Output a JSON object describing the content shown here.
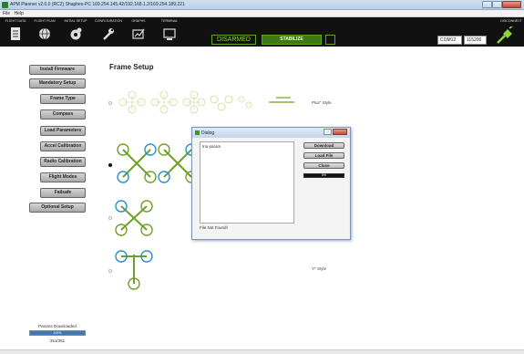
{
  "window": {
    "title": "APM Planner v2.0.0 (RC2) Shaphes-PC  169.254.145.42/192.168.1.2/169.254.189.221"
  },
  "menu": [
    "File",
    "Help"
  ],
  "toolbar": {
    "buttons": [
      {
        "label": "FLIGHT DATA",
        "icon": "document-icon"
      },
      {
        "label": "FLIGHT PLAN",
        "icon": "globe-icon"
      },
      {
        "label": "INITIAL SETUP",
        "icon": "gear-icon"
      },
      {
        "label": "CONFIGURATION",
        "icon": "wrench-icon"
      },
      {
        "label": "GRAPHS",
        "icon": "graph-icon"
      },
      {
        "label": "TERMINAL",
        "icon": "terminal-icon"
      }
    ],
    "armed_status": "DISARMED",
    "flight_mode": "STABILIZE",
    "com_port": "COM12",
    "baud_rate": "115200",
    "disconnect_label": "DISCONNECT",
    "accent_color": "#5fa61e"
  },
  "sidebar": {
    "items": [
      {
        "label": "Install Firmware",
        "level": 0
      },
      {
        "label": "Mandatory Setup",
        "level": 0
      },
      {
        "label": "Frame Type",
        "level": 1
      },
      {
        "label": "Compass",
        "level": 1
      },
      {
        "label": "Load Parameters",
        "level": 1
      },
      {
        "label": "Accel Calibration",
        "level": 1
      },
      {
        "label": "Radio Calibration",
        "level": 1
      },
      {
        "label": "Flight Modes",
        "level": 1
      },
      {
        "label": "Failsafe",
        "level": 1
      },
      {
        "label": "Optional Setup",
        "level": 0
      }
    ],
    "footer_text": "Params Downloaded",
    "progress_text": "100%",
    "progress": 1.0,
    "count_text": "351/351"
  },
  "main": {
    "title": "Frame Setup",
    "plus_label": "Plus\" Style",
    "y_label": "Y* Style"
  },
  "dialog": {
    "title": "Dialog",
    "text": "trio param",
    "status": "File Not Found!",
    "buttons": [
      "Download",
      "Load File",
      "Close"
    ],
    "progress_text": "0%"
  }
}
